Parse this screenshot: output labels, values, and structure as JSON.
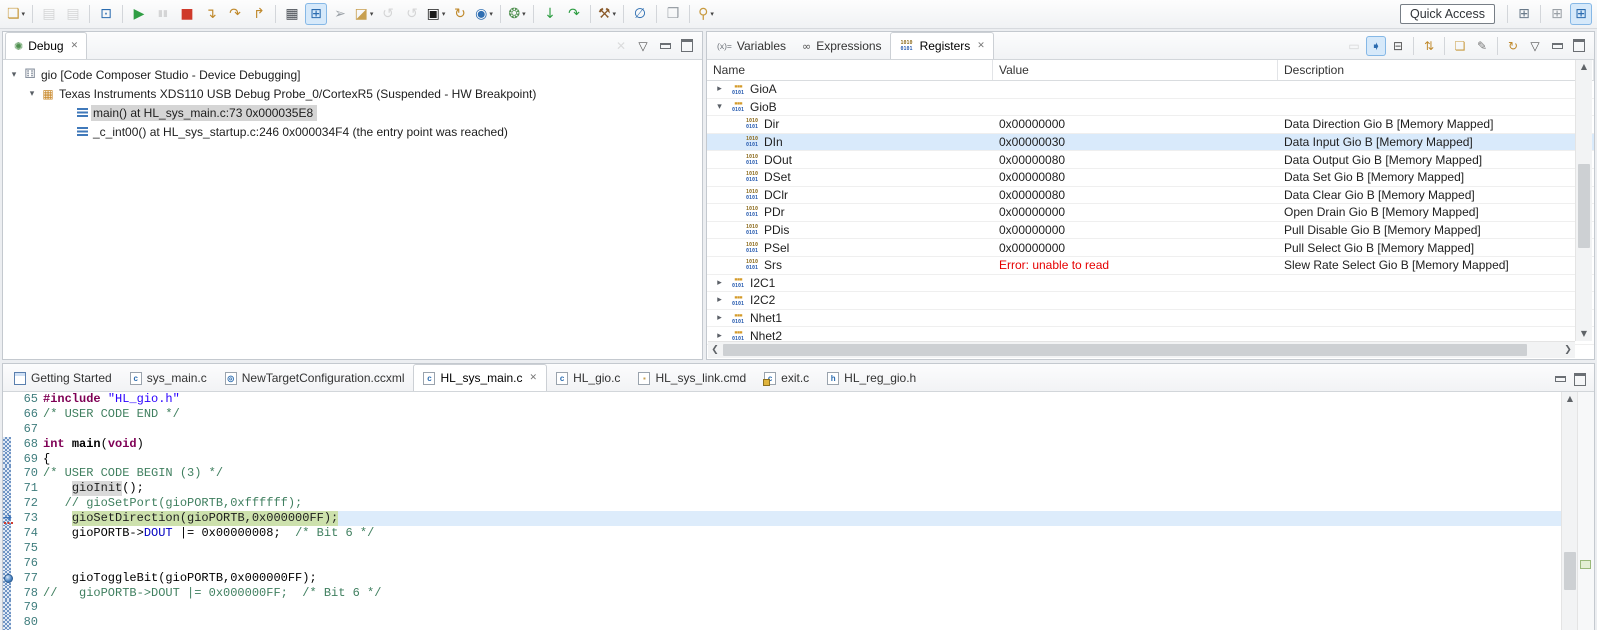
{
  "toolbar": {
    "quick_access": "Quick Access",
    "items": [
      {
        "name": "new",
        "glyph": "❏",
        "color": "#c89a3f",
        "dropdown": true
      },
      {
        "sep": true
      },
      {
        "name": "save",
        "glyph": "▤",
        "color": "#9aa0a6",
        "disabled": true
      },
      {
        "name": "save-all",
        "glyph": "▤",
        "color": "#9aa0a6",
        "disabled": true
      },
      {
        "sep": true
      },
      {
        "name": "debug-launch",
        "glyph": "⊡",
        "color": "#2b6cb0"
      },
      {
        "sep": true
      },
      {
        "name": "resume",
        "glyph": "▶",
        "color": "#2f9e44"
      },
      {
        "name": "suspend",
        "glyph": "▮▮",
        "color": "#9aa0a6",
        "disabled": true,
        "cls": "sm"
      },
      {
        "name": "terminate",
        "glyph": "■",
        "color": "#cf3a2b"
      },
      {
        "name": "step-into",
        "glyph": "↴",
        "color": "#c08a2d"
      },
      {
        "name": "step-over",
        "glyph": "↷",
        "color": "#c08a2d"
      },
      {
        "name": "step-return",
        "glyph": "↱",
        "color": "#c08a2d"
      },
      {
        "sep": true
      },
      {
        "name": "view-disassembly",
        "glyph": "▦",
        "color": "#4a4f55"
      },
      {
        "name": "connect-target",
        "glyph": "⊞",
        "color": "#2b6cb0",
        "active": true
      },
      {
        "name": "target-pointer",
        "glyph": "➢",
        "color": "#9aa0a6"
      },
      {
        "name": "load-program",
        "glyph": "◪",
        "color": "#c8a050",
        "dropdown": true
      },
      {
        "name": "restore-debug-state",
        "glyph": "↺",
        "color": "#9aa0a6",
        "disabled": true
      },
      {
        "name": "restore-debug-state-2",
        "glyph": "↺",
        "color": "#9aa0a6",
        "disabled": true
      },
      {
        "name": "flash-device",
        "glyph": "▣",
        "color": "#1a1a1a",
        "dropdown": true
      },
      {
        "name": "reset-cpu",
        "glyph": "↻",
        "color": "#c08a2d"
      },
      {
        "name": "restart",
        "glyph": "◉",
        "color": "#2f6fb3",
        "dropdown": true
      },
      {
        "sep": true
      },
      {
        "name": "breakpoints",
        "glyph": "❂",
        "color": "#4e8f4e",
        "dropdown": true
      },
      {
        "sep": true
      },
      {
        "name": "assembly-step-into",
        "glyph": "↓",
        "color": "#2f9e44"
      },
      {
        "name": "assembly-step-over",
        "glyph": "↷",
        "color": "#2f9e44"
      },
      {
        "sep": true
      },
      {
        "name": "build",
        "glyph": "⚒",
        "color": "#8a5a2a",
        "dropdown": true
      },
      {
        "sep": true
      },
      {
        "name": "inspect",
        "glyph": "∅",
        "color": "#2b6cb0"
      },
      {
        "sep": true
      },
      {
        "name": "show-view",
        "glyph": "❒",
        "color": "#9aa0a6"
      },
      {
        "sep": true
      },
      {
        "name": "search",
        "glyph": "⚲",
        "color": "#c89a3f",
        "dropdown": true
      }
    ],
    "perspectives": [
      {
        "name": "open-perspective",
        "glyph": "⊞",
        "color": "#6a7a8a"
      },
      {
        "sep": true
      },
      {
        "name": "ccs-edit-perspective",
        "glyph": "⊞",
        "color": "#9aa0a6"
      },
      {
        "name": "ccs-debug-perspective",
        "glyph": "⊞",
        "color": "#2b6cb0",
        "active": true
      }
    ]
  },
  "debug_panel": {
    "tab_label": "Debug",
    "actions": [
      {
        "name": "remove-all-terminated",
        "glyph": "✕",
        "color": "#b0b0b0",
        "disabled": true
      },
      {
        "name": "view-menu",
        "glyph": "▽",
        "color": "#555",
        "cls": "sm"
      },
      {
        "name": "minimize",
        "cls": "winmin"
      },
      {
        "name": "maximize",
        "cls": "winmax"
      }
    ],
    "tree": [
      {
        "level": 0,
        "expanded": true,
        "icon": "launch",
        "label": "gio [Code Composer Studio - Device Debugging]"
      },
      {
        "level": 1,
        "expanded": true,
        "icon": "probe",
        "label": "Texas Instruments XDS110 USB Debug Probe_0/CortexR5 (Suspended - HW Breakpoint)"
      },
      {
        "level": 2,
        "icon": "frame",
        "label": "main() at HL_sys_main.c:73 0x000035E8",
        "selected": true
      },
      {
        "level": 2,
        "icon": "frame",
        "label": "_c_int00() at HL_sys_startup.c:246 0x000034F4  (the entry point was reached)"
      }
    ]
  },
  "registers_panel": {
    "tabs": [
      {
        "label": "Variables",
        "icon": "vars"
      },
      {
        "label": "Expressions",
        "icon": "expr"
      },
      {
        "label": "Registers",
        "icon": "regs",
        "active": true,
        "close": true
      }
    ],
    "actions": [
      {
        "name": "show-type-names",
        "glyph": "▭",
        "color": "#9aa0a6",
        "disabled": true
      },
      {
        "name": "tree-mode",
        "glyph": "➧",
        "color": "#2b6cb0",
        "active": true
      },
      {
        "name": "collapse-all",
        "glyph": "⊟",
        "color": "#555"
      },
      {
        "sep": true
      },
      {
        "name": "export-import",
        "glyph": "⇅",
        "color": "#c08a2d"
      },
      {
        "sep": true
      },
      {
        "name": "new-register-group",
        "glyph": "❏",
        "color": "#c89a3f"
      },
      {
        "name": "edit-register-group",
        "glyph": "✎",
        "color": "#777"
      },
      {
        "sep": true
      },
      {
        "name": "refresh",
        "glyph": "↻",
        "color": "#c08a2d"
      },
      {
        "name": "view-menu",
        "glyph": "▽",
        "color": "#555",
        "cls": "sm"
      },
      {
        "name": "minimize",
        "cls": "winmin"
      },
      {
        "name": "maximize",
        "cls": "winmax"
      }
    ],
    "columns": [
      "Name",
      "Value",
      "Description"
    ],
    "rows": [
      {
        "type": "group",
        "name": "GioA",
        "expanded": false,
        "value": "",
        "desc": ""
      },
      {
        "type": "group",
        "name": "GioB",
        "expanded": true,
        "value": "",
        "desc": ""
      },
      {
        "type": "reg",
        "name": "Dir",
        "value": "0x00000000",
        "desc": "Data Direction Gio B [Memory Mapped]"
      },
      {
        "type": "reg",
        "name": "DIn",
        "value": "0x00000030",
        "desc": "Data Input Gio B [Memory Mapped]",
        "selected": true
      },
      {
        "type": "reg",
        "name": "DOut",
        "value": "0x00000080",
        "desc": "Data Output Gio B [Memory Mapped]"
      },
      {
        "type": "reg",
        "name": "DSet",
        "value": "0x00000080",
        "desc": "Data Set Gio B [Memory Mapped]"
      },
      {
        "type": "reg",
        "name": "DClr",
        "value": "0x00000080",
        "desc": "Data Clear Gio B [Memory Mapped]"
      },
      {
        "type": "reg",
        "name": "PDr",
        "value": "0x00000000",
        "desc": "Open Drain Gio B [Memory Mapped]"
      },
      {
        "type": "reg",
        "name": "PDis",
        "value": "0x00000000",
        "desc": "Pull Disable Gio B [Memory Mapped]"
      },
      {
        "type": "reg",
        "name": "PSel",
        "value": "0x00000000",
        "desc": "Pull Select Gio B [Memory Mapped]"
      },
      {
        "type": "reg",
        "name": "Srs",
        "value": "Error: unable to read",
        "error": true,
        "desc": "Slew Rate Select Gio B [Memory Mapped]"
      },
      {
        "type": "group",
        "name": "I2C1",
        "expanded": false,
        "value": "",
        "desc": ""
      },
      {
        "type": "group",
        "name": "I2C2",
        "expanded": false,
        "value": "",
        "desc": ""
      },
      {
        "type": "group",
        "name": "Nhet1",
        "expanded": false,
        "value": "",
        "desc": ""
      },
      {
        "type": "group",
        "name": "Nhet2",
        "expanded": false,
        "value": "",
        "desc": ""
      }
    ]
  },
  "editor": {
    "tabs": [
      {
        "label": "Getting Started",
        "icon": "window"
      },
      {
        "label": "sys_main.c",
        "icon": "c"
      },
      {
        "label": "NewTargetConfiguration.ccxml",
        "icon": "ccxml"
      },
      {
        "label": "HL_sys_main.c",
        "icon": "c",
        "active": true,
        "close": true
      },
      {
        "label": "HL_gio.c",
        "icon": "c"
      },
      {
        "label": "HL_sys_link.cmd",
        "icon": "cmd"
      },
      {
        "label": "exit.c",
        "icon": "c-gold"
      },
      {
        "label": "HL_reg_gio.h",
        "icon": "h"
      }
    ],
    "lines": [
      {
        "n": 65,
        "t": [
          [
            "k",
            "#include "
          ],
          [
            "s",
            "\"HL_gio.h\""
          ]
        ]
      },
      {
        "n": 66,
        "t": [
          [
            "c",
            "/* USER CODE END */"
          ]
        ]
      },
      {
        "n": 67,
        "t": []
      },
      {
        "n": 68,
        "diff": true,
        "t": [
          [
            "k",
            "int"
          ],
          [
            "p",
            " "
          ],
          [
            "f",
            "main"
          ],
          [
            "p",
            "("
          ],
          [
            "k",
            "void"
          ],
          [
            "p",
            ")"
          ]
        ]
      },
      {
        "n": 69,
        "diff": true,
        "t": [
          [
            "p",
            "{"
          ]
        ]
      },
      {
        "n": 70,
        "diff": true,
        "t": [
          [
            "c",
            "/* USER CODE BEGIN (3) */"
          ]
        ]
      },
      {
        "n": 71,
        "diff": true,
        "t": [
          [
            "p",
            "    "
          ],
          [
            "o",
            "gioInit"
          ],
          [
            "p",
            "();"
          ]
        ]
      },
      {
        "n": 72,
        "diff": true,
        "t": [
          [
            "c",
            "   // gioSetPort(gioPORTB,0xffffff);"
          ]
        ]
      },
      {
        "n": 73,
        "diff": true,
        "current": true,
        "gutter": "arrow",
        "t": [
          [
            "p",
            "    "
          ],
          [
            "hl",
            "gioSetDirection(gioPORTB,0x000000FF);"
          ]
        ]
      },
      {
        "n": 74,
        "diff": true,
        "t": [
          [
            "p",
            "    gioPORTB->"
          ],
          [
            "m",
            "DOUT"
          ],
          [
            "p",
            " |= 0x00000008;  "
          ],
          [
            "c",
            "/* Bit 6 */"
          ]
        ]
      },
      {
        "n": 75,
        "diff": true,
        "t": []
      },
      {
        "n": 76,
        "diff": true,
        "t": []
      },
      {
        "n": 77,
        "diff": true,
        "gutter": "breakpoint",
        "t": [
          [
            "p",
            "    gioToggleBit(gioPORTB,0x000000FF);"
          ]
        ]
      },
      {
        "n": 78,
        "diff": true,
        "t": [
          [
            "c",
            "//   gioPORTB->DOUT |= 0x000000FF;  /* Bit 6 */"
          ]
        ]
      },
      {
        "n": 79,
        "diff": true,
        "t": []
      },
      {
        "n": 80,
        "diff": true,
        "t": []
      }
    ]
  }
}
